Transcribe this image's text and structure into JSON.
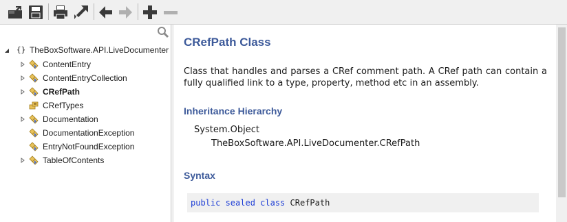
{
  "toolbar": {
    "buttons": [
      {
        "name": "open-button",
        "icon": "open-folder-icon"
      },
      {
        "name": "save-button",
        "icon": "floppy-disk-icon"
      },
      {
        "name": "print-button",
        "icon": "printer-icon"
      },
      {
        "name": "expand-button",
        "icon": "expand-arrow-icon"
      },
      {
        "name": "back-button",
        "icon": "arrow-left-icon"
      },
      {
        "name": "forward-button",
        "icon": "arrow-right-icon",
        "disabled": true
      },
      {
        "name": "zoom-in-button",
        "icon": "plus-icon"
      },
      {
        "name": "zoom-out-button",
        "icon": "minus-icon",
        "disabled": true
      }
    ]
  },
  "tree": {
    "root": {
      "label": "TheBoxSoftware.API.LiveDocumenter",
      "icon": "namespace-braces-icon"
    },
    "items": [
      {
        "label": "ContentEntry",
        "icon": "class-icon",
        "expandable": true,
        "selected": false
      },
      {
        "label": "ContentEntryCollection",
        "icon": "class-icon",
        "expandable": true,
        "selected": false
      },
      {
        "label": "CRefPath",
        "icon": "class-icon",
        "expandable": true,
        "selected": true
      },
      {
        "label": "CRefTypes",
        "icon": "enum-icon",
        "expandable": false,
        "selected": false
      },
      {
        "label": "Documentation",
        "icon": "class-icon",
        "expandable": true,
        "selected": false
      },
      {
        "label": "DocumentationException",
        "icon": "class-icon",
        "expandable": false,
        "selected": false
      },
      {
        "label": "EntryNotFoundException",
        "icon": "class-icon",
        "expandable": false,
        "selected": false
      },
      {
        "label": "TableOfContents",
        "icon": "class-icon",
        "expandable": true,
        "selected": false
      }
    ]
  },
  "content": {
    "title": "CRefPath Class",
    "description": "Class that handles and parses a CRef comment path. A CRef path can contain a fully qualified link to a type, property, method etc in an assembly.",
    "inheritance_heading": "Inheritance Hierarchy",
    "inheritance": [
      "System.Object",
      "TheBoxSoftware.API.LiveDocumenter.CRefPath"
    ],
    "syntax_heading": "Syntax",
    "syntax": {
      "keywords": "public sealed class",
      "name": "CRefPath"
    }
  },
  "colors": {
    "heading": "#3d5a9a",
    "keyword": "#1f3fd6",
    "toolbar_bg": "#f0f0f0"
  }
}
